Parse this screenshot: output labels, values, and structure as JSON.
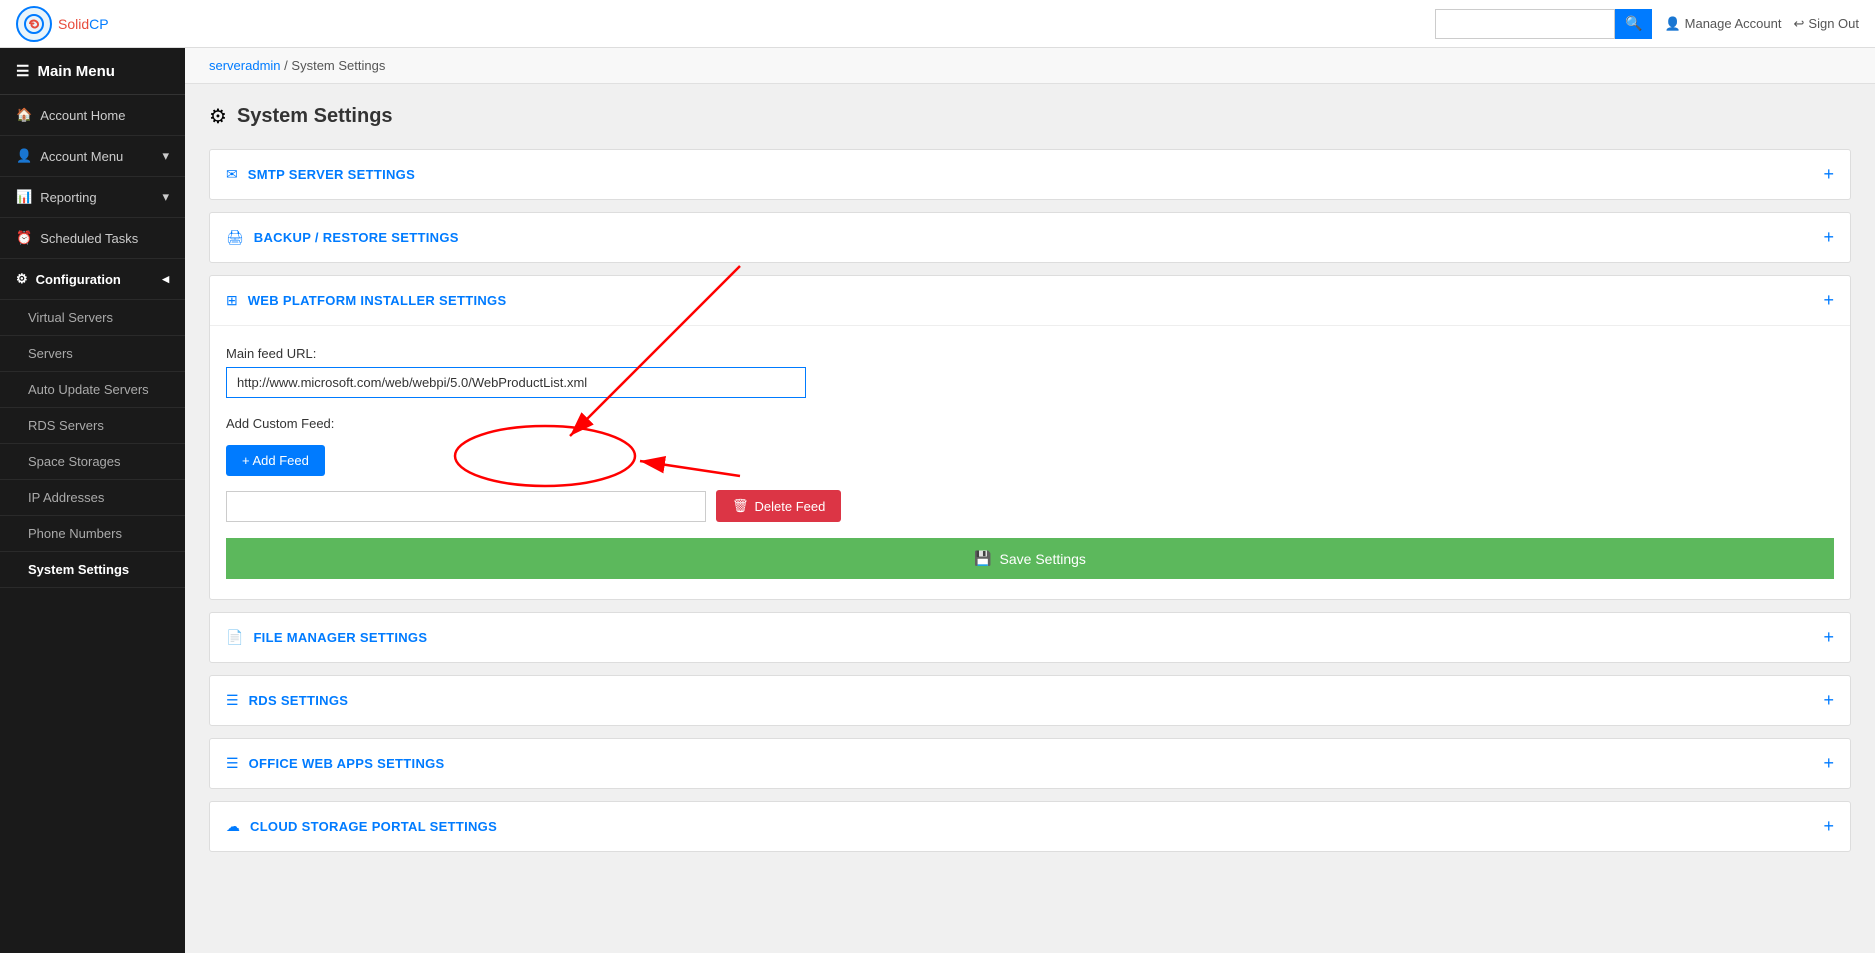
{
  "topbar": {
    "logo_solid": "Solid",
    "logo_cp": "CP",
    "search_placeholder": "",
    "manage_account_label": "Manage Account",
    "sign_out_label": "Sign Out"
  },
  "sidebar": {
    "main_menu_label": "Main Menu",
    "items": [
      {
        "id": "account-home",
        "label": "Account Home",
        "icon": "🏠",
        "has_sub": false,
        "active": false
      },
      {
        "id": "account-menu",
        "label": "Account Menu",
        "icon": "👤",
        "has_sub": true,
        "active": false
      },
      {
        "id": "reporting",
        "label": "Reporting",
        "icon": "📊",
        "has_sub": true,
        "active": false
      },
      {
        "id": "scheduled-tasks",
        "label": "Scheduled Tasks",
        "icon": "⏰",
        "has_sub": false,
        "active": false
      },
      {
        "id": "configuration",
        "label": "Configuration",
        "icon": "⚙",
        "has_sub": true,
        "active": true
      }
    ],
    "sub_items": [
      {
        "id": "virtual-servers",
        "label": "Virtual Servers",
        "active": false
      },
      {
        "id": "servers",
        "label": "Servers",
        "active": false
      },
      {
        "id": "auto-update-servers",
        "label": "Auto Update Servers",
        "active": false
      },
      {
        "id": "rds-servers",
        "label": "RDS Servers",
        "active": false
      },
      {
        "id": "space-storages",
        "label": "Space Storages",
        "active": false
      },
      {
        "id": "ip-addresses",
        "label": "IP Addresses",
        "active": false
      },
      {
        "id": "phone-numbers",
        "label": "Phone Numbers",
        "active": false
      },
      {
        "id": "system-settings",
        "label": "System Settings",
        "active": true
      }
    ]
  },
  "breadcrumb": {
    "link_text": "serveradmin",
    "separator": "/",
    "current": "System Settings"
  },
  "page": {
    "title": "System Settings"
  },
  "sections": [
    {
      "id": "smtp",
      "icon": "✉",
      "title": "SMTP SERVER SETTINGS",
      "expanded": false
    },
    {
      "id": "backup",
      "icon": "🖨",
      "title": "BACKUP / RESTORE SETTINGS",
      "expanded": false
    },
    {
      "id": "webpi",
      "icon": "⊞",
      "title": "WEB PLATFORM INSTALLER SETTINGS",
      "expanded": true,
      "fields": {
        "main_feed_label": "Main feed URL:",
        "main_feed_value": "http://www.microsoft.com/web/webpi/5.0/WebProductList.xml",
        "add_custom_feed_label": "Add Custom Feed:",
        "add_feed_btn": "+ Add Feed",
        "custom_feed_value": "",
        "delete_feed_btn": "Delete Feed",
        "save_btn": "Save Settings"
      }
    },
    {
      "id": "file-manager",
      "icon": "📄",
      "title": "FILE MANAGER SETTINGS",
      "expanded": false
    },
    {
      "id": "rds",
      "icon": "☰",
      "title": "RDS SETTINGS",
      "expanded": false
    },
    {
      "id": "office-web-apps",
      "icon": "☰",
      "title": "OFFICE WEB APPS SETTINGS",
      "expanded": false
    },
    {
      "id": "cloud-storage",
      "icon": "☁",
      "title": "CLOUD STORAGE PORTAL SETTINGS",
      "expanded": false
    }
  ]
}
